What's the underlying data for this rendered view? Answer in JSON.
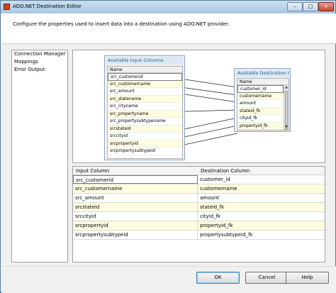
{
  "window": {
    "title": "ADO.NET Destination Editor",
    "description": "Configure the properties used to insert data into a destination using ADO.NET provider."
  },
  "nav": {
    "items": [
      "Connection Manager",
      "Mappings",
      "Error Output"
    ]
  },
  "available_input": {
    "title": "Available Input Columns",
    "header": "Name",
    "items": [
      "src_customerid",
      "src_customername",
      "src_amount",
      "src_statename",
      "src_cityname",
      "src_propertyname",
      "src_propertysubtypename",
      "srcstateid",
      "srccityid",
      "srcpropertyid",
      "srcpropertysubtypeid"
    ]
  },
  "available_destination": {
    "title": "Available Destination C...",
    "header": "Name",
    "items": [
      "customer_id",
      "customername",
      "amount",
      "stateid_fk",
      "cityid_fk",
      "propertyid_fk"
    ]
  },
  "mappings": {
    "headers": [
      "Input Column",
      "Destination Column"
    ],
    "rows": [
      [
        "src_customerid",
        "customer_id"
      ],
      [
        "src_customername",
        "customername"
      ],
      [
        "src_amount",
        "amount"
      ],
      [
        "srcstateid",
        "stateid_fk"
      ],
      [
        "srccityid",
        "cityid_fk"
      ],
      [
        "srcpropertyid",
        "propertyid_fk"
      ],
      [
        "srcpropertysubtypeid",
        "propertysubtypeid_fk"
      ]
    ]
  },
  "buttons": {
    "ok": "OK",
    "cancel": "Cancel",
    "help": "Help"
  },
  "window_controls": {
    "min": "–",
    "max": "□",
    "close": "×"
  }
}
